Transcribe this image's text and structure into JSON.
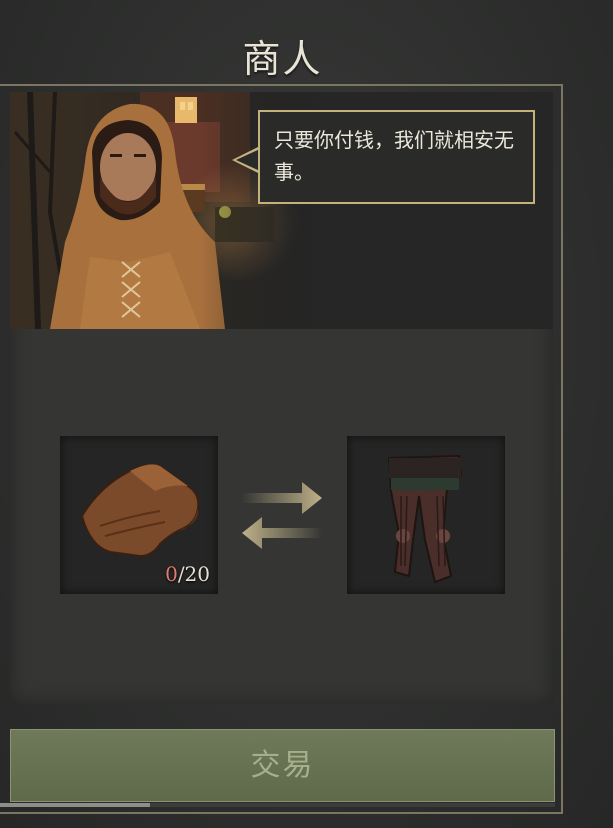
{
  "header": {
    "title": "商人"
  },
  "merchant": {
    "dialogue": "只要你付钱，我们就相安无事。"
  },
  "trade": {
    "give_item": {
      "icon": "leather-scrap-icon",
      "have": "0",
      "need": "/20"
    },
    "receive_item": {
      "icon": "leather-pants-icon"
    },
    "exchange_icon": "exchange-arrows-icon"
  },
  "actions": {
    "trade_label": "交易"
  },
  "colors": {
    "frame": "#7a7662",
    "speech_border": "#c4b27c",
    "trade_button": "#6f7a5a",
    "insufficient": "#e07b6f"
  }
}
